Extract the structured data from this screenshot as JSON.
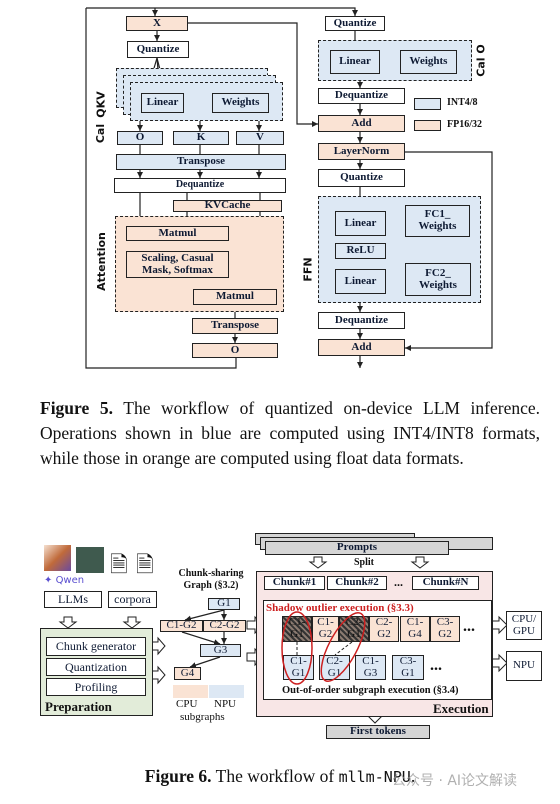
{
  "fig5": {
    "x": "X",
    "quantize": "Quantize",
    "linear": "Linear",
    "weights": "Weights",
    "qkv": "QKV",
    "cal": "Cal",
    "q": "O",
    "k": "K",
    "v": "V",
    "transpose": "Transpose",
    "dequantize": "Dequantize",
    "kvcache": "KVCache",
    "attention": "Attention",
    "matmul": "Matmul",
    "scaling": "Scaling, Casual Mask, Softmax",
    "o": "O",
    "cal_o": "Cal  O",
    "add": "Add",
    "layernorm": "LayerNorm",
    "relu": "ReLU",
    "fc1": "FC1_ Weights",
    "fc2": "FC2_ Weights",
    "ffn": "FFN",
    "legend": [
      {
        "label": "INT4/8",
        "color": "#dde8f4"
      },
      {
        "label": "FP16/32",
        "color": "#fae3d4"
      }
    ],
    "caption_label": "Figure 5.",
    "caption": "The workflow of quantized on-device LLM inference. Operations shown in blue are computed using INT4/INT8 formats, while those in orange are computed using float data formats."
  },
  "fig6": {
    "logo_text": "Qwen",
    "llms": "LLMs",
    "corpora": "corpora",
    "prep_items": [
      "Chunk generator",
      "Quantization",
      "Profiling"
    ],
    "preparation": "Preparation",
    "graph_title": "Chunk-sharing Graph (§3.2)",
    "g1": "G1",
    "c1g2": "C1-G2",
    "c2g2": "C2-G2",
    "g3": "G3",
    "g4": "G4",
    "legend_cpu": "CPU",
    "legend_npu": "NPU",
    "legend_sub": "subgraphs",
    "prompts": "Prompts",
    "split": "Split",
    "chunks": [
      "Chunk#1",
      "Chunk#2",
      "...",
      "Chunk#N"
    ],
    "shadow": "Shadow outlier execution (§3.3)",
    "top_row": [
      "C1- G1",
      "C1- G2",
      "C2- G1",
      "C2- G2",
      "C1- G4",
      "C3- G2",
      "..."
    ],
    "bottom_row": [
      "C1- G1",
      "C2- G1",
      "C1- G3",
      "C3- G1",
      "..."
    ],
    "ooo": "Out-of-order subgraph execution (§3.4)",
    "execution": "Execution",
    "cpu_gpu": "CPU/ GPU",
    "npu": "NPU",
    "first_tokens": "First tokens",
    "caption_label": "Figure 6.",
    "caption_pre": "The workflow of ",
    "caption_mono": "mllm-NPU",
    ".": ".",
    "watermark": "公众号 · AI论文解读"
  },
  "colors": {
    "int": "#dde8f4",
    "fp": "#fae3d4",
    "prep": "#e2ecd9",
    "exec": "#f8e6e6",
    "accent_red": "#cc1f1f"
  }
}
